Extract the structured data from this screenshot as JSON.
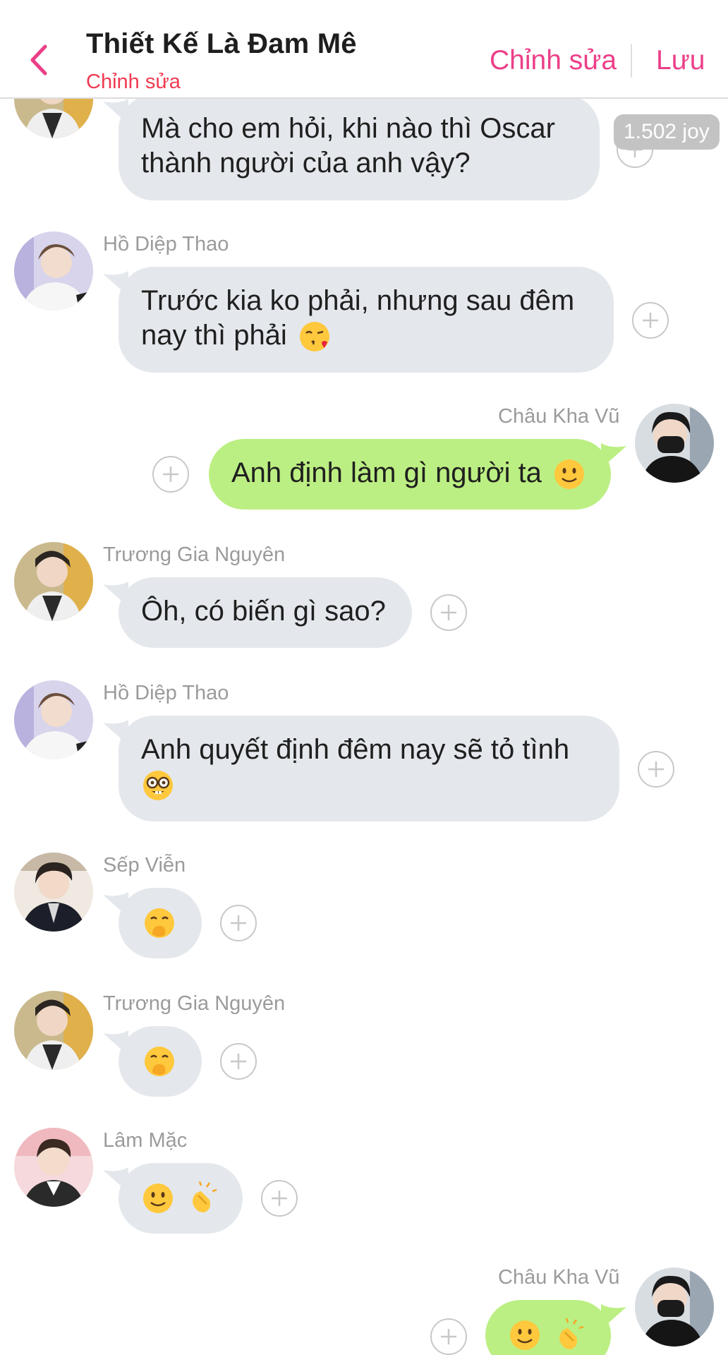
{
  "header": {
    "title": "Thiết Kế Là Đam Mê",
    "subtitle": "Chỉnh sửa",
    "edit_label": "Chỉnh sửa",
    "save_label": "Lưu"
  },
  "badge": {
    "text": "1.502 joy"
  },
  "messages": [
    {
      "sender": "",
      "text": "Mà cho em hỏi, khi nào thì Oscar thành người của anh vậy?"
    },
    {
      "sender": "Hồ Diệp Thao",
      "text": "Trước kia ko phải, nhưng sau đêm nay thì phải"
    },
    {
      "sender": "Châu Kha Vũ",
      "text": "Anh định làm gì người ta"
    },
    {
      "sender": "Trương Gia Nguyên",
      "text": "Ôh, có biến gì sao?"
    },
    {
      "sender": "Hồ Diệp Thao",
      "text": "Anh quyết định đêm nay sẽ tỏ tình"
    },
    {
      "sender": "Sếp Viễn",
      "text": ""
    },
    {
      "sender": "Trương Gia Nguyên",
      "text": ""
    },
    {
      "sender": "Lâm Mặc",
      "text": ""
    },
    {
      "sender": "Châu Kha Vũ",
      "text": ""
    }
  ],
  "colors": {
    "accent": "#ec3f88",
    "subtitle": "#ef3a52",
    "incoming_bubble": "#e4e8ec",
    "outgoing_bubble": "#bcef83",
    "sender_name": "#9b9b9b"
  },
  "icons": {
    "back": "chevron-left-icon",
    "add_reaction": "plus-circle-icon",
    "emojis": [
      "kissing-heart-emoji",
      "slightly-smiling-emoji",
      "nerd-face-emoji",
      "hand-over-mouth-emoji",
      "clapping-hands-emoji"
    ]
  }
}
